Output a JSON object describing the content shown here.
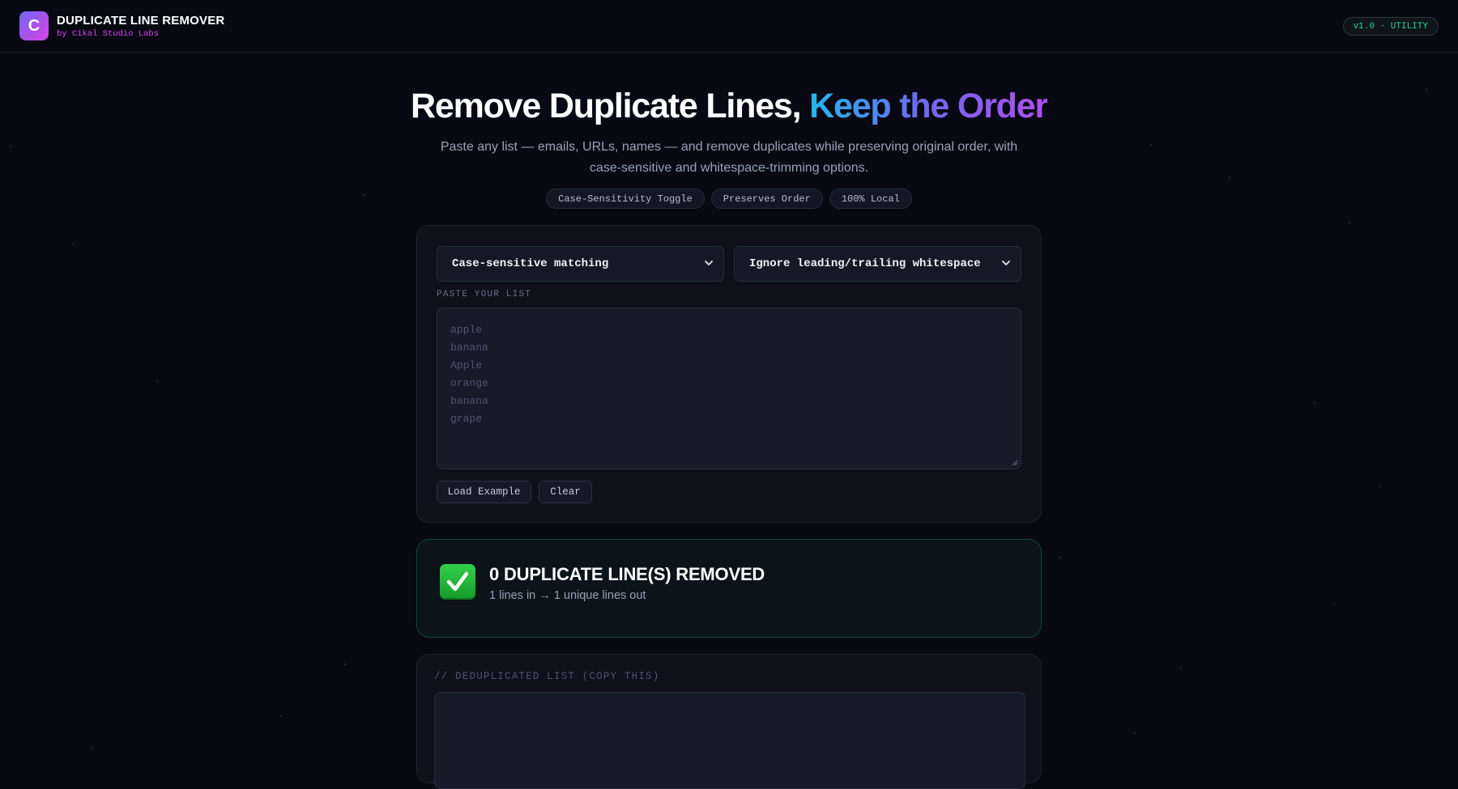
{
  "header": {
    "logo_letter": "C",
    "title": "DUPLICATE LINE REMOVER",
    "subtitle": "by Cikal Studio Labs",
    "version_badge": "v1.0 · UTILITY"
  },
  "hero": {
    "title_main": "Remove Duplicate Lines,",
    "title_accent": "Keep the Order",
    "description": "Paste any list — emails, URLs, names — and remove duplicates while preserving original order, with case-sensitive and whitespace-trimming options.",
    "tags": [
      "Case-Sensitivity Toggle",
      "Preserves Order",
      "100% Local"
    ]
  },
  "options": {
    "case_select": "Case-sensitive matching",
    "whitespace_select": "Ignore leading/trailing whitespace"
  },
  "input": {
    "label": "PASTE YOUR LIST",
    "placeholder_lines": [
      "apple",
      "banana",
      "Apple",
      "orange",
      "banana",
      "grape"
    ],
    "load_example": "Load Example",
    "clear": "Clear"
  },
  "result": {
    "title": "0 DUPLICATE LINE(S) REMOVED",
    "summary": "1 lines in → 1 unique lines out"
  },
  "output": {
    "label": "// DEDUPLICATED LIST (COPY THIS)",
    "value": ""
  },
  "colors": {
    "background": "#080913",
    "accent_success": "#34d399",
    "accent_pink": "#d946ef"
  }
}
